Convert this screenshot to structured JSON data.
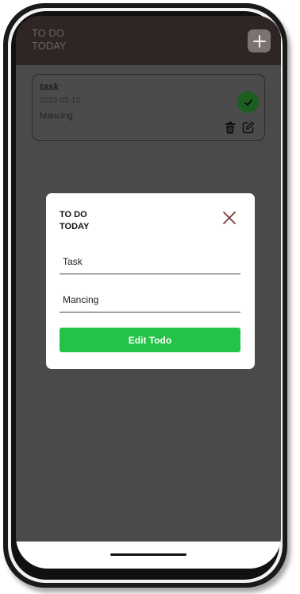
{
  "header": {
    "title": "TO DO\nTODAY",
    "add_icon": "plus-icon"
  },
  "todo": {
    "title": "task",
    "date": "2023-05-15",
    "description": "Mancing",
    "icons": [
      "check-icon",
      "trash-icon",
      "edit-icon"
    ]
  },
  "modal": {
    "title": "TO DO\nTODAY",
    "close_icon": "close-icon",
    "task_value": "Task",
    "description_value": "Mancing",
    "submit_label": "Edit Todo"
  },
  "colors": {
    "header_bg": "#2e2524",
    "screen_bg": "#4a4a4a",
    "accent_green": "#22c346",
    "check_green": "#1b5e20",
    "close_icon": "#7a3b3b"
  }
}
